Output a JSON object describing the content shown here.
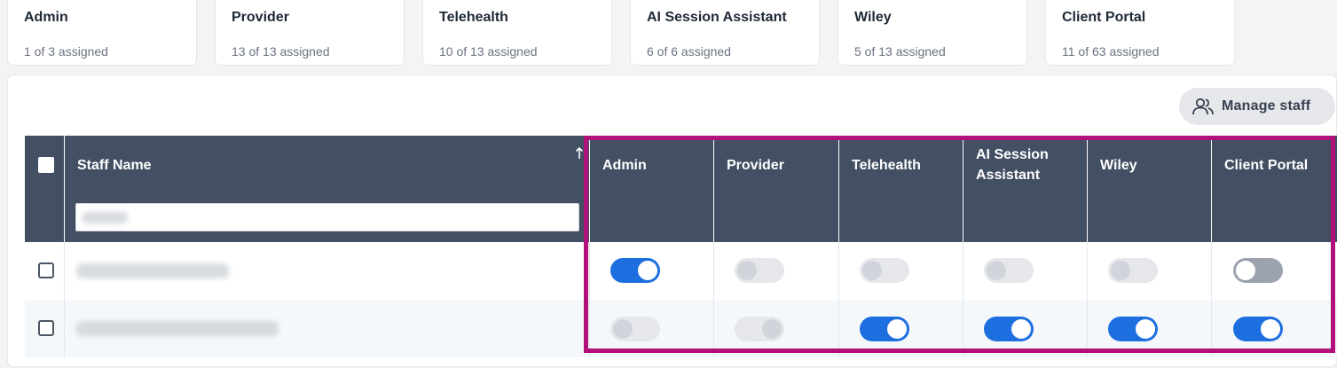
{
  "cards": [
    {
      "title": "Admin",
      "assigned": "1 of 3 assigned"
    },
    {
      "title": "Provider",
      "assigned": "13 of 13 assigned"
    },
    {
      "title": "Telehealth",
      "assigned": "10 of 13 assigned"
    },
    {
      "title": "AI Session Assistant",
      "assigned": "6 of 6 assigned"
    },
    {
      "title": "Wiley",
      "assigned": "5 of 13 assigned"
    },
    {
      "title": "Client Portal",
      "assigned": "11 of 63 assigned"
    }
  ],
  "toolbar": {
    "manage_staff_label": "Manage staff",
    "manage_staff_icon": "users-icon"
  },
  "table": {
    "staff_name_header": "Staff Name",
    "sort_icon": "arrow-up-icon",
    "columns": [
      "Admin",
      "Provider",
      "Telehealth",
      "AI Session Assistant",
      "Wiley",
      "Client Portal"
    ],
    "rows": [
      {
        "toggles": [
          "on",
          "off-disabled",
          "off-disabled",
          "off-disabled",
          "off-disabled",
          "off"
        ]
      },
      {
        "toggles": [
          "off-disabled",
          "on-disabled",
          "on",
          "on",
          "on",
          "on"
        ]
      }
    ]
  },
  "colors": {
    "header_bg": "#434f63",
    "toggle_on": "#1d6fe0",
    "highlight_border": "#b0117b"
  }
}
